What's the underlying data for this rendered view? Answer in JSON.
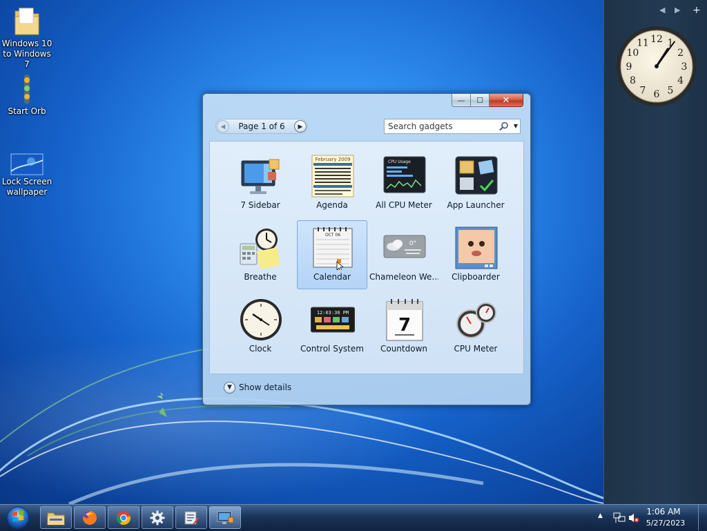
{
  "desktop": {
    "icons": [
      {
        "label": "Windows 10\nto Windows 7",
        "icon": "folder-icon"
      },
      {
        "label": "Start Orb",
        "icon": "traffic-light-icon"
      },
      {
        "label": "Lock Screen\nwallpaper",
        "icon": "wallpaper-thumbnail-icon"
      }
    ]
  },
  "sidebar": {
    "controls": [
      "◀",
      "▶",
      "+"
    ],
    "clock": {
      "numbers": [
        "12",
        "1",
        "2",
        "3",
        "4",
        "5",
        "6",
        "7",
        "8",
        "9",
        "10",
        "11"
      ],
      "hour": 1,
      "minute": 6
    }
  },
  "gadget_window": {
    "caption": {
      "minimize": "—",
      "maximize": "☐",
      "close": "✕"
    },
    "pager": {
      "label": "Page 1 of 6",
      "current": 1,
      "total": 6
    },
    "search": {
      "placeholder": "Search gadgets"
    },
    "gadgets": [
      {
        "label": "7 Sidebar",
        "icon": "monitor-sidebar-icon"
      },
      {
        "label": "Agenda",
        "icon": "agenda-calendar-icon",
        "thumb_text": "February 2009"
      },
      {
        "label": "All CPU Meter",
        "icon": "cpu-graph-icon",
        "thumb_text": "CPU Usage"
      },
      {
        "label": "App Launcher",
        "icon": "app-launcher-icon"
      },
      {
        "label": "Breathe",
        "icon": "clock-calculator-note-icon"
      },
      {
        "label": "Calendar",
        "icon": "desk-calendar-icon",
        "thumb_text": "OCT 06",
        "selected": true
      },
      {
        "label": "Chameleon We...",
        "icon": "weather-cloud-icon",
        "thumb_text": "0°"
      },
      {
        "label": "Clipboarder",
        "icon": "baby-photo-icon"
      },
      {
        "label": "Clock",
        "icon": "analog-clock-icon"
      },
      {
        "label": "Control System",
        "icon": "control-system-icon",
        "thumb_text": "12:03:30 PM"
      },
      {
        "label": "Countdown",
        "icon": "countdown-calendar-icon",
        "thumb_text": "7"
      },
      {
        "label": "CPU Meter",
        "icon": "cpu-gauge-icon"
      }
    ],
    "details_label": "Show details"
  },
  "taskbar": {
    "pinned": [
      {
        "name": "file-explorer",
        "icon": "folder-icon"
      },
      {
        "name": "firefox",
        "icon": "firefox-icon"
      },
      {
        "name": "chrome",
        "icon": "chrome-icon"
      },
      {
        "name": "settings",
        "icon": "gear-icon"
      },
      {
        "name": "tool",
        "icon": "tool-app-icon"
      },
      {
        "name": "gadgets",
        "icon": "gadgets-monitor-icon"
      }
    ],
    "tray": {
      "time": "1:06 AM",
      "date": "5/27/2023"
    }
  }
}
